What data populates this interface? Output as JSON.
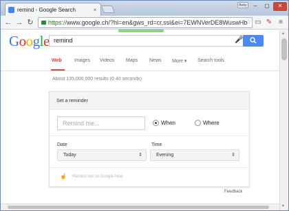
{
  "browser": {
    "tab_title": "remind - Google Search",
    "tab_close": "×",
    "user_badge": "Betty",
    "window_controls": [
      "–",
      "▢",
      "✕"
    ],
    "url_https": "https://",
    "url_rest": "www.google.ch/?hl=en&gws_rd=cr,ssl&ei=7EWNVerDE8WuswHb",
    "icons": [
      "back-icon",
      "forward-icon",
      "reload-icon",
      "star-icon",
      "cast-icon",
      "extension-icon",
      "menu-icon"
    ]
  },
  "google": {
    "logo": {
      "G": "G",
      "o1": "o",
      "o2": "o",
      "g": "g",
      "l": "l",
      "e": "e"
    },
    "query": "remind",
    "search_button_icon": "search-icon",
    "tabs": [
      "Web",
      "Images",
      "Videos",
      "Maps",
      "News",
      "More ▾",
      "Search tools"
    ],
    "stats": "About 135,000,000 results (0.40 seconds)"
  },
  "reminder": {
    "heading": "Set a reminder",
    "input_placeholder": "Remind me...",
    "when_label": "When",
    "where_label": "Where",
    "date_label": "Date",
    "date_value": "Today",
    "time_label": "Time",
    "time_value": "Evening",
    "footer_text": "Remind me on Google Now"
  },
  "feedback": "Feedback",
  "colors": {
    "accent_red": "#dd4b39",
    "search_blue": "#4a8af4",
    "https_green": "#1a7a1a"
  }
}
